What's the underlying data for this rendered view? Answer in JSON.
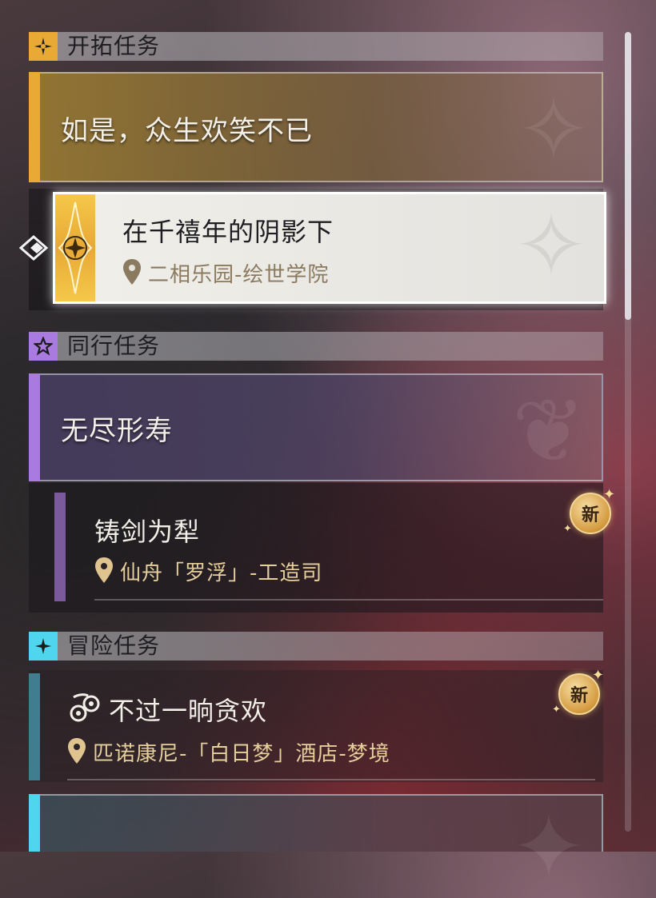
{
  "sections": [
    {
      "title": "开拓任务",
      "icon": "trailblaze-icon",
      "accent": "#e8a935",
      "group_title": "如是，众生欢笑不已",
      "quests": [
        {
          "name": "在千禧年的阴影下",
          "location": "二相乐园-绘世学院",
          "selected": true
        }
      ]
    },
    {
      "title": "同行任务",
      "icon": "companion-star-icon",
      "accent": "#a97ae0",
      "group_title": "无尽形寿",
      "quests": [
        {
          "name": "铸剑为犁",
          "location": "仙舟「罗浮」-工造司",
          "new": "新"
        }
      ]
    },
    {
      "title": "冒险任务",
      "icon": "adventure-icon",
      "accent": "#4fd6ee",
      "quests": [
        {
          "name": "不过一晌贪欢",
          "location": "匹诺康尼-「白日梦」酒店-梦境",
          "new": "新"
        }
      ]
    }
  ]
}
